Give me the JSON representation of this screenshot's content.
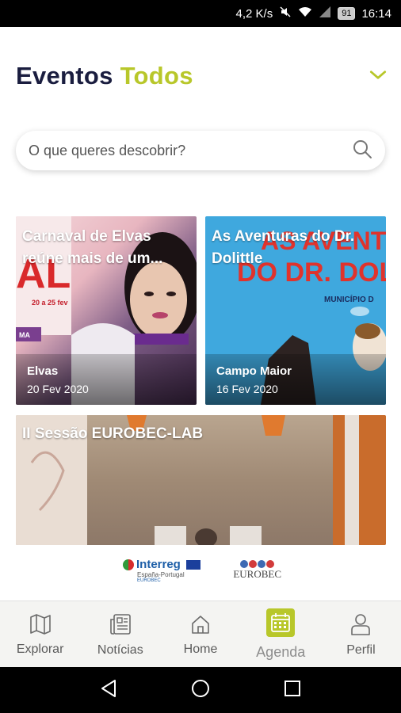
{
  "status": {
    "net": "4,2 K/s",
    "battery": "91",
    "time": "16:14"
  },
  "header": {
    "title1": "Eventos",
    "title2": "Todos"
  },
  "search": {
    "placeholder": "O que queres descobrir?"
  },
  "events": [
    {
      "title": "Carnaval de Elvas reúne mais de um...",
      "location": "Elvas",
      "date": "20 Fev 2020",
      "poster_text": "AL",
      "poster_dates": "20 a 25 fev",
      "poster_badge": "MA"
    },
    {
      "title": "As Aventuras do Dr. Dolittle",
      "location": "Campo Maior",
      "date": "16 Fev 2020",
      "poster_line1": "AS AVENT",
      "poster_line2": "DO DR. DOL",
      "poster_line3": "MUNICÍPIO D"
    },
    {
      "title": "II Sessão EUROBEC-LAB"
    }
  ],
  "logos": {
    "interreg": "Interreg",
    "interreg_sub": "España-Portugal",
    "interreg_sub2": "EUROBEC",
    "eurobec": "EUROBEC"
  },
  "nav": [
    {
      "label": "Explorar",
      "icon": "map-icon"
    },
    {
      "label": "Notícias",
      "icon": "news-icon"
    },
    {
      "label": "Home",
      "icon": "home-icon"
    },
    {
      "label": "Agenda",
      "icon": "calendar-icon"
    },
    {
      "label": "Perfil",
      "icon": "user-icon"
    }
  ],
  "colors": {
    "accent": "#b8c72a",
    "title_dark": "#1a1d3f"
  }
}
